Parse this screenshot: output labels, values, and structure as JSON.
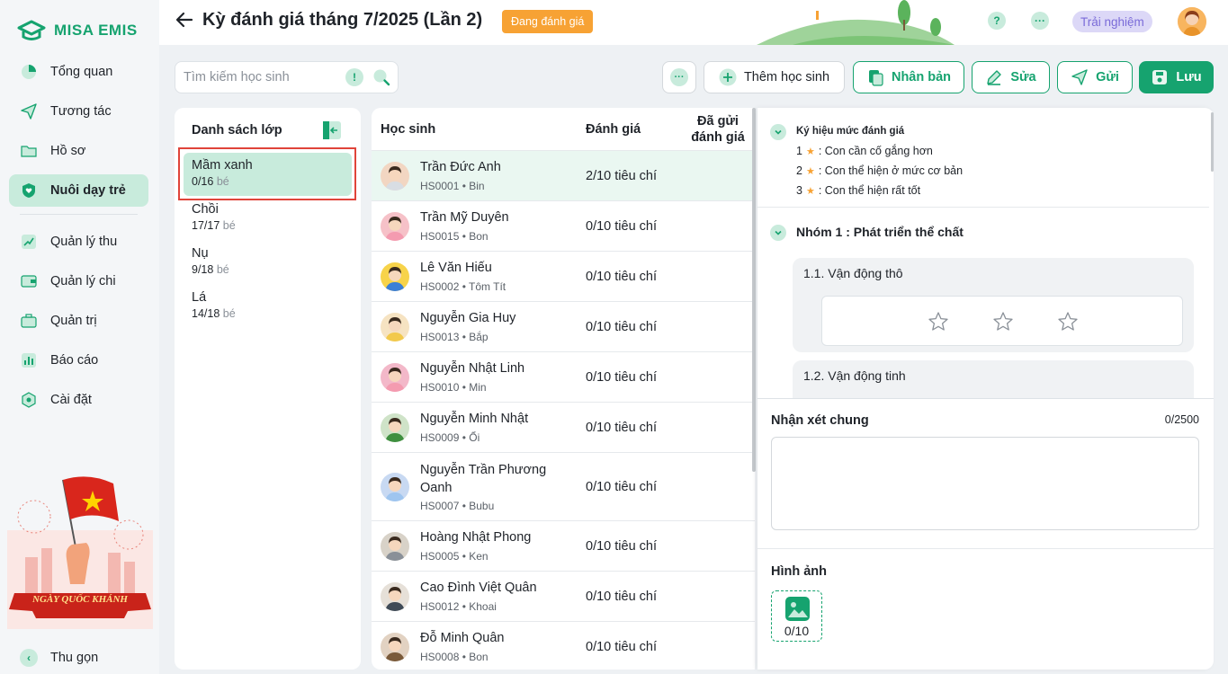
{
  "brand": "MISA EMIS",
  "sidebar": {
    "items": [
      {
        "label": "Tổng quan"
      },
      {
        "label": "Tương tác"
      },
      {
        "label": "Hồ sơ"
      },
      {
        "label": "Nuôi dạy trẻ"
      },
      {
        "label": "Quản lý thu"
      },
      {
        "label": "Quản lý chi"
      },
      {
        "label": "Quản trị"
      },
      {
        "label": "Báo cáo"
      },
      {
        "label": "Cài đặt"
      }
    ],
    "active_index": 3,
    "collapse_label": "Thu gọn",
    "promo_text": "NGÀY QUỐC KHÁNH"
  },
  "header": {
    "title": "Kỳ đánh giá tháng 7/2025 (Lần 2)",
    "status": "Đang đánh giá",
    "help": "?",
    "more": "···",
    "trial": "Trải nghiệm"
  },
  "toolbar": {
    "search_placeholder": "Tìm kiếm học sinh",
    "more": "···",
    "add_student": "Thêm học sinh",
    "duplicate": "Nhân bản",
    "edit": "Sửa",
    "send": "Gửi",
    "save": "Lưu"
  },
  "classes": {
    "title": "Danh sách lớp",
    "unit": "bé",
    "items": [
      {
        "name": "Mầm xanh",
        "count": "0/16"
      },
      {
        "name": "Chồi",
        "count": "17/17"
      },
      {
        "name": "Nụ",
        "count": "9/18"
      },
      {
        "name": "Lá",
        "count": "14/18"
      }
    ]
  },
  "students": {
    "col_student": "Học sinh",
    "col_eval": "Đánh giá",
    "col_sent": "Đã gửi đánh giá",
    "rows": [
      {
        "name": "Trần Đức Anh",
        "code": "HS0001 • Bin",
        "eval": "2/10 tiêu chí"
      },
      {
        "name": "Trần Mỹ Duyên",
        "code": "HS0015 • Bon",
        "eval": "0/10 tiêu chí"
      },
      {
        "name": "Lê Văn Hiếu",
        "code": "HS0002 • Tôm Tít",
        "eval": "0/10 tiêu chí"
      },
      {
        "name": "Nguyễn Gia Huy",
        "code": "HS0013 • Bắp",
        "eval": "0/10 tiêu chí"
      },
      {
        "name": "Nguyễn Nhật Linh",
        "code": "HS0010 • Min",
        "eval": "0/10 tiêu chí"
      },
      {
        "name": "Nguyễn Minh Nhật",
        "code": "HS0009 • Ổi",
        "eval": "0/10 tiêu chí"
      },
      {
        "name": "Nguyễn Trần Phương Oanh",
        "code": "HS0007 • Bubu",
        "eval": "0/10 tiêu chí"
      },
      {
        "name": "Hoàng Nhật Phong",
        "code": "HS0005 • Ken",
        "eval": "0/10 tiêu chí"
      },
      {
        "name": "Cao Đình Việt Quân",
        "code": "HS0012 • Khoai",
        "eval": "0/10 tiêu chí"
      },
      {
        "name": "Đỗ Minh Quân",
        "code": "HS0008 • Bon",
        "eval": "0/10 tiêu chí"
      }
    ]
  },
  "rating": {
    "legend_title": "Ký hiệu mức đánh giá",
    "legend": [
      {
        "level": "1",
        "text": ": Con cần cố gắng hơn"
      },
      {
        "level": "2",
        "text": ": Con thể hiện ở mức cơ bản"
      },
      {
        "level": "3",
        "text": ": Con thể hiện rất tốt"
      }
    ],
    "group_title": "Nhóm 1 : Phát triển thể chất",
    "criteria": [
      {
        "title": "1.1. Vận động thô",
        "stars": 0
      },
      {
        "title": "1.2. Vận động tinh"
      }
    ],
    "comment_label": "Nhận xét chung",
    "comment_count": "0/2500",
    "comment_value": "",
    "image_label": "Hình ảnh",
    "image_count": "0/10"
  },
  "colors": {
    "primary": "#16a36f",
    "primary_light": "#c8ebdc",
    "status_badge": "#f7a234",
    "trial_bg": "#dcd8f7"
  }
}
